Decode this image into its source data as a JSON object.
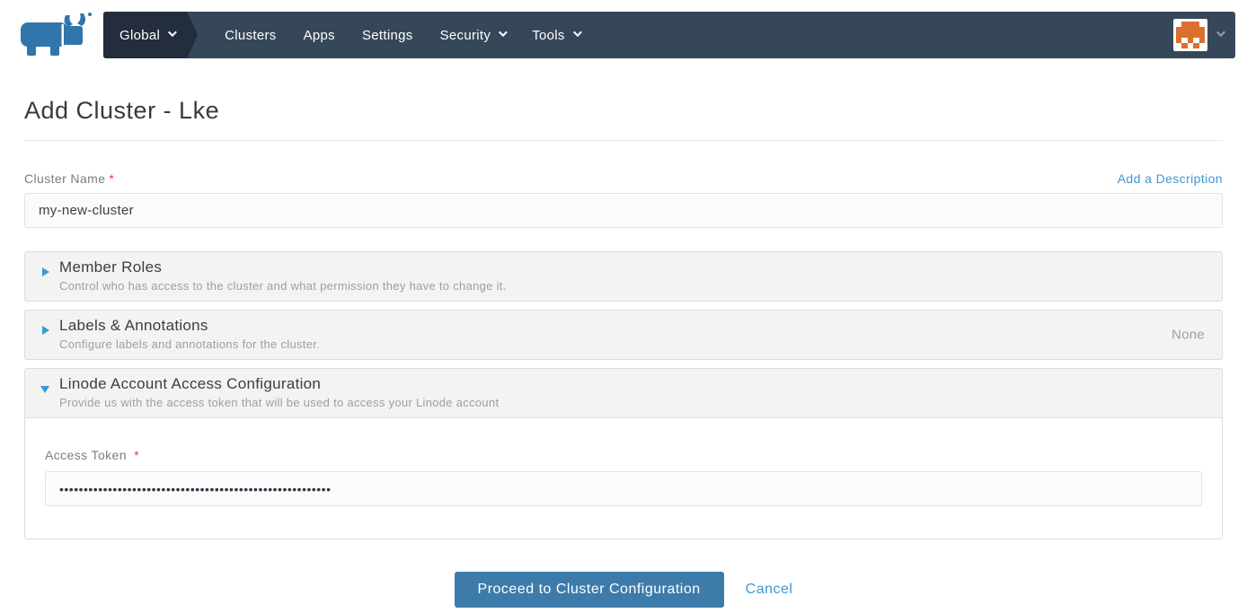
{
  "nav": {
    "logo_name": "rancher-cow-logo",
    "global_label": "Global",
    "items": [
      {
        "label": "Clusters",
        "has_dropdown": false
      },
      {
        "label": "Apps",
        "has_dropdown": false
      },
      {
        "label": "Settings",
        "has_dropdown": false
      },
      {
        "label": "Security",
        "has_dropdown": true
      },
      {
        "label": "Tools",
        "has_dropdown": true
      }
    ]
  },
  "avatar": {
    "color": "#d9702e",
    "pattern": [
      [
        0,
        1,
        1,
        1,
        0
      ],
      [
        1,
        1,
        1,
        1,
        1
      ],
      [
        1,
        1,
        1,
        1,
        1
      ],
      [
        1,
        0,
        1,
        0,
        1
      ],
      [
        0,
        1,
        0,
        1,
        0
      ]
    ]
  },
  "page": {
    "title": "Add Cluster - Lke"
  },
  "form": {
    "cluster_name": {
      "label": "Cluster Name",
      "required_mark": "*",
      "value": "my-new-cluster"
    },
    "add_description_link": "Add a Description",
    "sections": [
      {
        "title": "Member Roles",
        "description": "Control who has access to the cluster and what permission they have to change it.",
        "state": "collapsed",
        "right_text": ""
      },
      {
        "title": "Labels & Annotations",
        "description": "Configure labels and annotations for the cluster.",
        "state": "collapsed",
        "right_text": "None"
      },
      {
        "title": "Linode Account Access Configuration",
        "description": "Provide us with the access token that will be used to access your Linode account",
        "state": "expanded",
        "right_text": ""
      }
    ],
    "access_token": {
      "label": "Access Token",
      "required_mark": "*",
      "masked_value": "••••••••••••••••••••••••••••••••••••••••••••••••••••••••"
    }
  },
  "footer": {
    "proceed_label": "Proceed to Cluster Configuration",
    "cancel_label": "Cancel"
  },
  "colors": {
    "navbar_bg": "#36475a",
    "navbar_active_bg": "#232d3b",
    "link_blue": "#3d98d3",
    "button_blue": "#3d7caa",
    "identicon_orange": "#d9702e",
    "required_red": "#cf4848",
    "section_bg": "#f3f3f3"
  }
}
